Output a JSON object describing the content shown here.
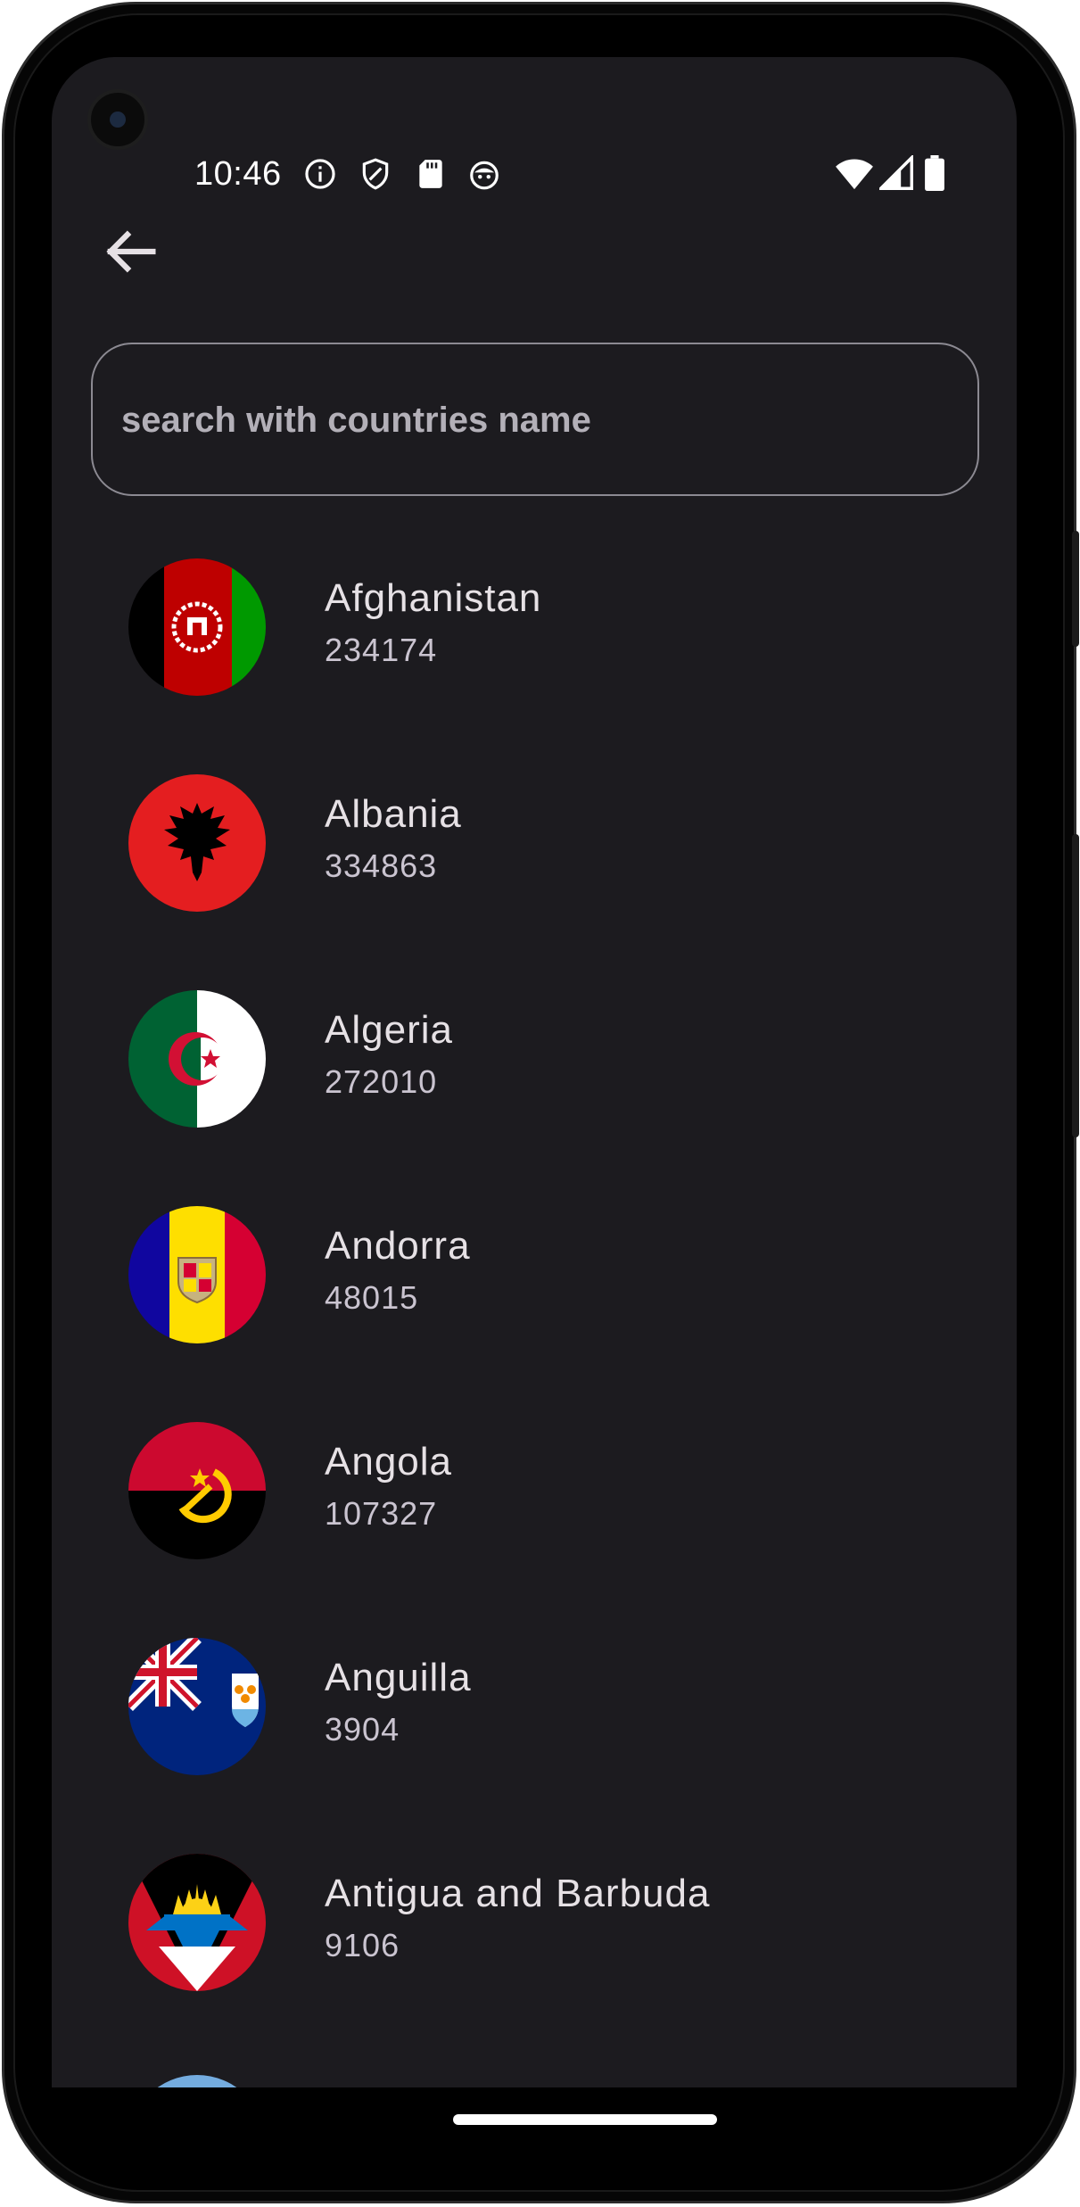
{
  "status_bar": {
    "time": "10:46",
    "left_icons": [
      "info-icon",
      "shield-icon",
      "sd-card-icon",
      "android-icon"
    ],
    "right_icons": [
      "wifi-icon",
      "signal-icon",
      "battery-icon"
    ]
  },
  "app_bar": {
    "back_icon": "arrow-back-icon"
  },
  "search": {
    "placeholder": "search with countries name",
    "value": ""
  },
  "countries": [
    {
      "name": "Afghanistan",
      "value": "234174",
      "flag": "afghanistan-flag-icon"
    },
    {
      "name": "Albania",
      "value": "334863",
      "flag": "albania-flag-icon"
    },
    {
      "name": "Algeria",
      "value": "272010",
      "flag": "algeria-flag-icon"
    },
    {
      "name": "Andorra",
      "value": "48015",
      "flag": "andorra-flag-icon"
    },
    {
      "name": "Angola",
      "value": "107327",
      "flag": "angola-flag-icon"
    },
    {
      "name": "Anguilla",
      "value": "3904",
      "flag": "anguilla-flag-icon"
    },
    {
      "name": "Antigua and Barbuda",
      "value": "9106",
      "flag": "antigua-flag-icon"
    }
  ],
  "colors": {
    "background": "#1c1b1f",
    "primary_text": "#e6e1e5",
    "secondary_text": "#cac4d0",
    "outline": "#8c8a92"
  }
}
